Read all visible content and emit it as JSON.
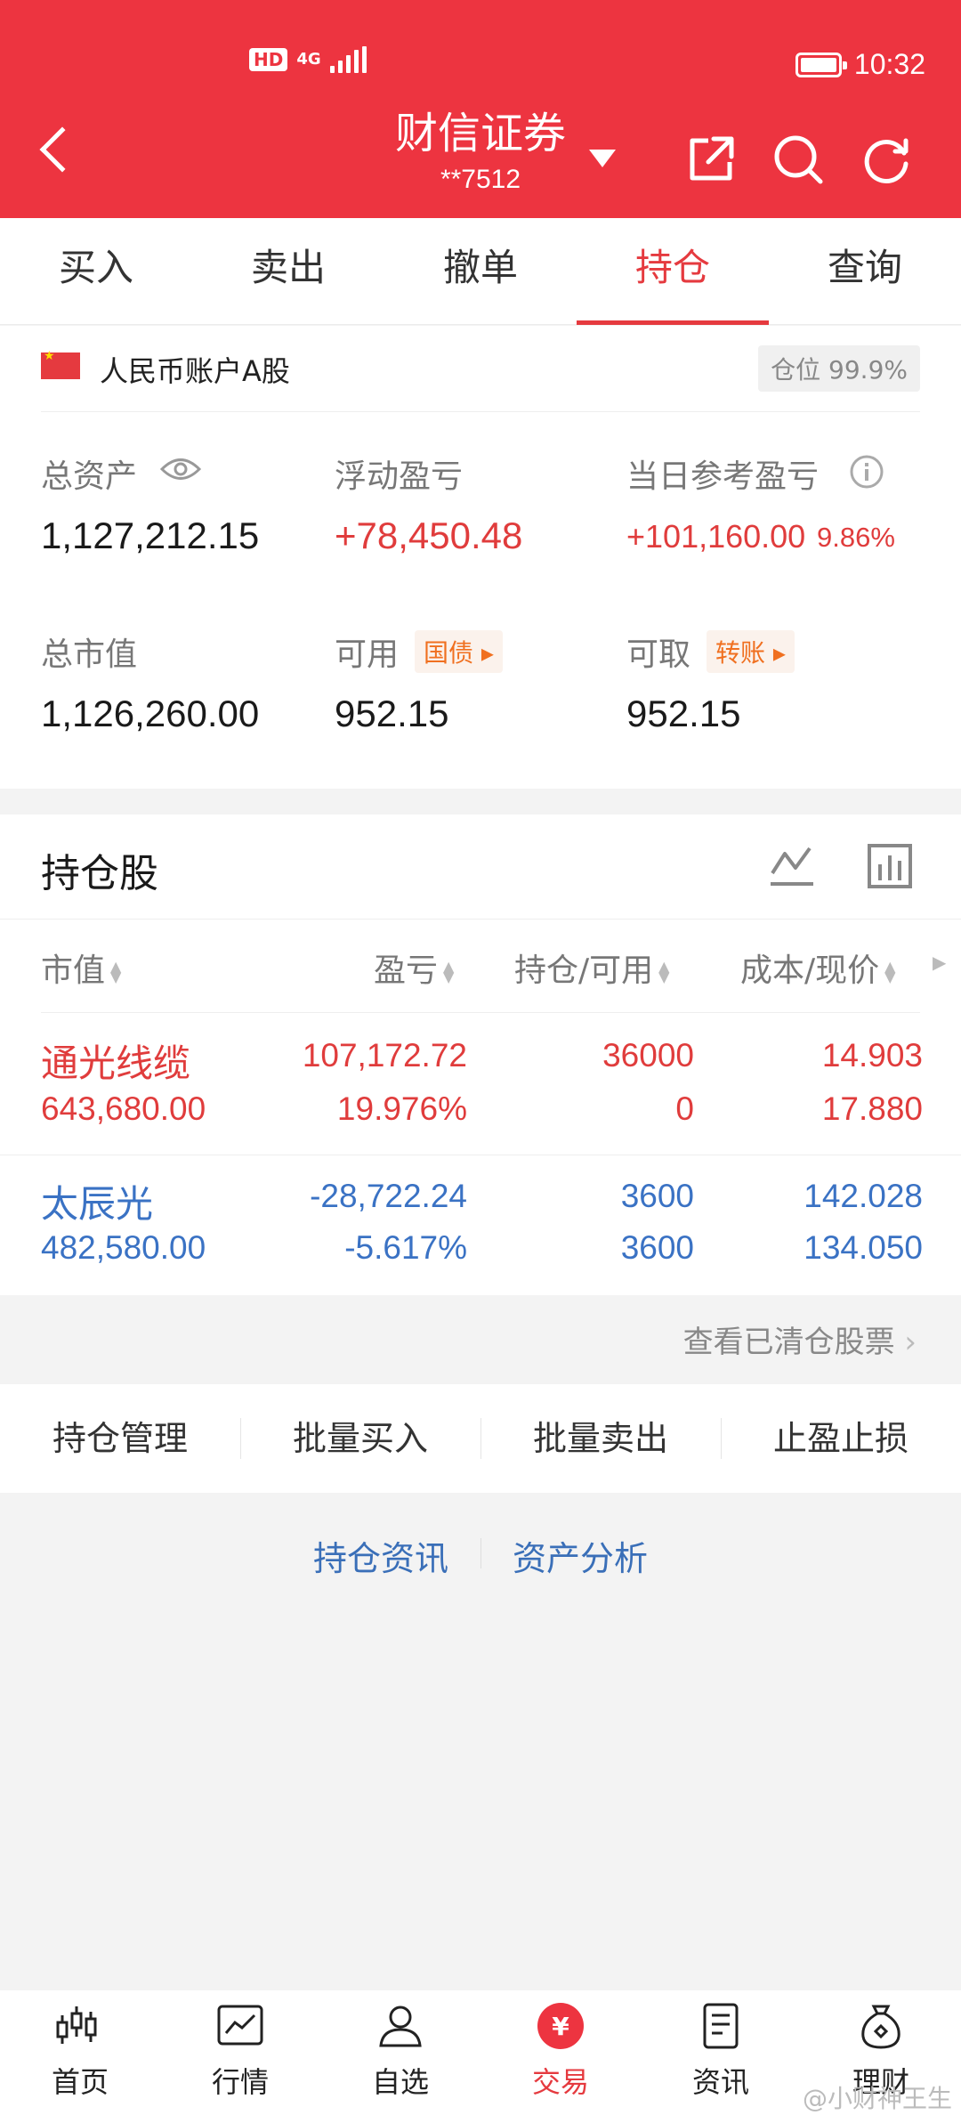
{
  "status": {
    "hd": "HD",
    "network": "4G",
    "time": "10:32"
  },
  "header": {
    "title": "财信证券",
    "account": "**7512"
  },
  "tabs": [
    "买入",
    "卖出",
    "撤单",
    "持仓",
    "查询"
  ],
  "summary": {
    "account_label": "人民币账户A股",
    "position": "仓位 99.9%",
    "total_assets_label": "总资产",
    "total_assets": "1,127,212.15",
    "float_pl_label": "浮动盈亏",
    "float_pl": "+78,450.48",
    "day_pl_label": "当日参考盈亏",
    "day_pl": "+101,160.00",
    "day_pl_pct": "9.86%",
    "market_value_label": "总市值",
    "market_value": "1,126,260.00",
    "available_label": "可用",
    "available_tag": "国债",
    "available": "952.15",
    "withdrawable_label": "可取",
    "withdrawable_tag": "转账",
    "withdrawable": "952.15"
  },
  "holdings": {
    "title": "持仓股",
    "columns": [
      "市值",
      "盈亏",
      "持仓/可用",
      "成本/现价"
    ],
    "rows": [
      {
        "name": "通光线缆",
        "market_value": "643,680.00",
        "pl": "107,172.72",
        "pl_pct": "19.976%",
        "hold": "36000",
        "avail": "0",
        "cost": "14.903",
        "price": "17.880"
      },
      {
        "name": "太辰光",
        "market_value": "482,580.00",
        "pl": "-28,722.24",
        "pl_pct": "-5.617%",
        "hold": "3600",
        "avail": "3600",
        "cost": "142.028",
        "price": "134.050"
      }
    ]
  },
  "cleared_link": "查看已清仓股票",
  "actions": [
    "持仓管理",
    "批量买入",
    "批量卖出",
    "止盈止损"
  ],
  "links": [
    "持仓资讯",
    "资产分析"
  ],
  "bottom_nav": [
    "首页",
    "行情",
    "自选",
    "交易",
    "资讯",
    "理财"
  ],
  "watermark": "@小财神王生",
  "colors": {
    "brand": "#ed3440",
    "up": "#e03c3c",
    "down": "#3a72c4"
  }
}
